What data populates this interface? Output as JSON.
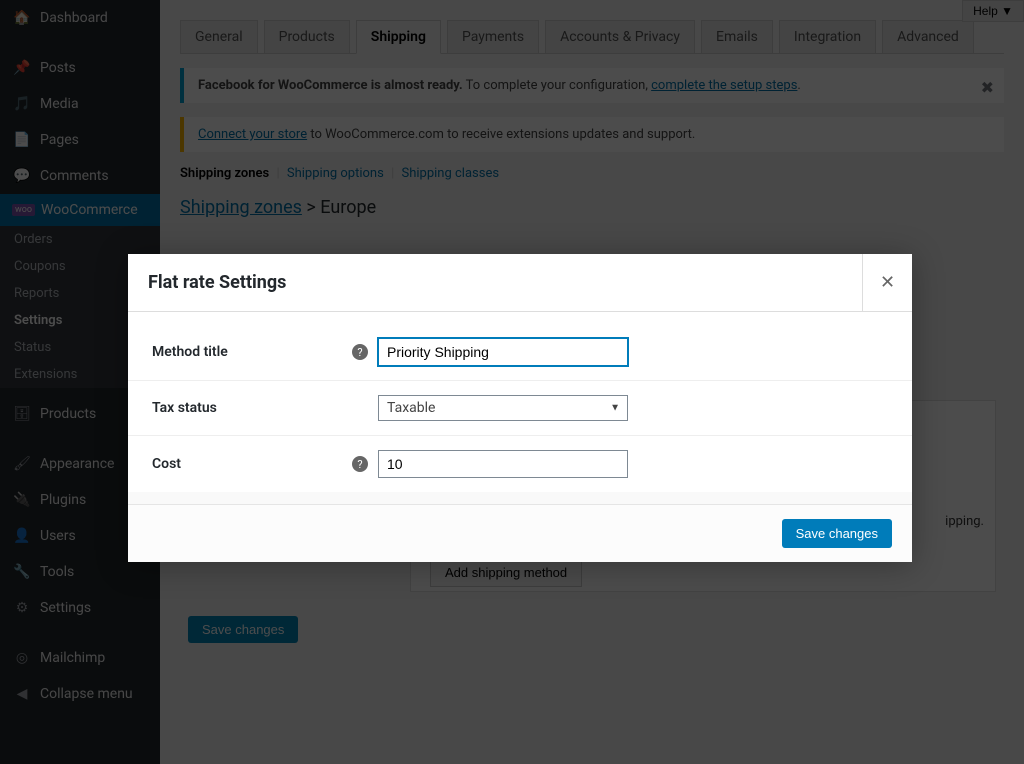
{
  "sidebar": {
    "items": [
      {
        "label": "Dashboard",
        "icon": "⌂"
      },
      {
        "label": "Posts",
        "icon": "✎"
      },
      {
        "label": "Media",
        "icon": "🖼"
      },
      {
        "label": "Pages",
        "icon": "▤"
      },
      {
        "label": "Comments",
        "icon": "💬"
      },
      {
        "label": "WooCommerce",
        "icon": "woo"
      },
      {
        "label": "Products",
        "icon": "📦"
      },
      {
        "label": "Appearance",
        "icon": "🖌"
      },
      {
        "label": "Plugins",
        "icon": "🔌"
      },
      {
        "label": "Users",
        "icon": "👤"
      },
      {
        "label": "Tools",
        "icon": "🔧"
      },
      {
        "label": "Settings",
        "icon": "⚙"
      },
      {
        "label": "Mailchimp",
        "icon": "✉"
      },
      {
        "label": "Collapse menu",
        "icon": "◀"
      }
    ],
    "woo_sub": [
      {
        "label": "Orders"
      },
      {
        "label": "Coupons"
      },
      {
        "label": "Reports"
      },
      {
        "label": "Settings"
      },
      {
        "label": "Status"
      },
      {
        "label": "Extensions"
      }
    ]
  },
  "help_label": "Help ▼",
  "tabs": [
    {
      "label": "General"
    },
    {
      "label": "Products"
    },
    {
      "label": "Shipping"
    },
    {
      "label": "Payments"
    },
    {
      "label": "Accounts & Privacy"
    },
    {
      "label": "Emails"
    },
    {
      "label": "Integration"
    },
    {
      "label": "Advanced"
    }
  ],
  "notice1": {
    "bold": "Facebook for WooCommerce is almost ready.",
    "text": " To complete your configuration, ",
    "link": "complete the setup steps",
    "dot": "."
  },
  "notice2": {
    "link": "Connect your store",
    "text": " to WooCommerce.com to receive extensions updates and support."
  },
  "subnav": {
    "zones": "Shipping zones",
    "options": "Shipping options",
    "classes": "Shipping classes"
  },
  "breadcrumb": {
    "zones": "Shipping zones",
    "sep": " > ",
    "current": "Europe"
  },
  "shipping_row_trailing": "ipping.",
  "add_method_label": "Add shipping method",
  "save_main_label": "Save changes",
  "modal": {
    "title": "Flat rate Settings",
    "close": "✕",
    "method_title_label": "Method title",
    "method_title_value": "Priority Shipping",
    "tax_status_label": "Tax status",
    "tax_status_value": "Taxable",
    "cost_label": "Cost",
    "cost_value": "10",
    "save_label": "Save changes",
    "help_glyph": "?"
  }
}
